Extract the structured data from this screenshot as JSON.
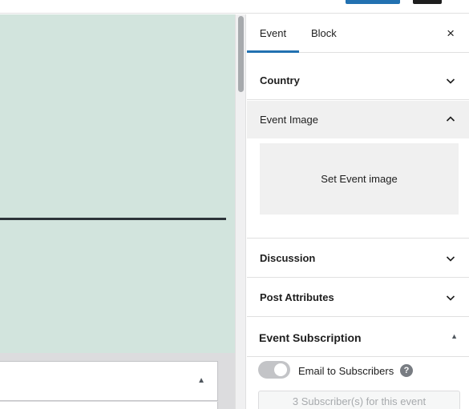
{
  "sidebar": {
    "tabs": [
      {
        "label": "Event"
      },
      {
        "label": "Block"
      }
    ],
    "close_icon": "×",
    "panels": {
      "country": {
        "label": "Country"
      },
      "event_image": {
        "label": "Event Image",
        "button_label": "Set Event image"
      },
      "discussion": {
        "label": "Discussion"
      },
      "post_attributes": {
        "label": "Post Attributes"
      },
      "event_subscription": {
        "label": "Event Subscription",
        "toggle_label": "Email to Subscribers",
        "help_icon": "?",
        "subscriber_count": "3 Subscriber(s) for this event"
      }
    }
  },
  "colors": {
    "accent": "#2271b1",
    "canvas_bg": "#d2e4dd"
  }
}
